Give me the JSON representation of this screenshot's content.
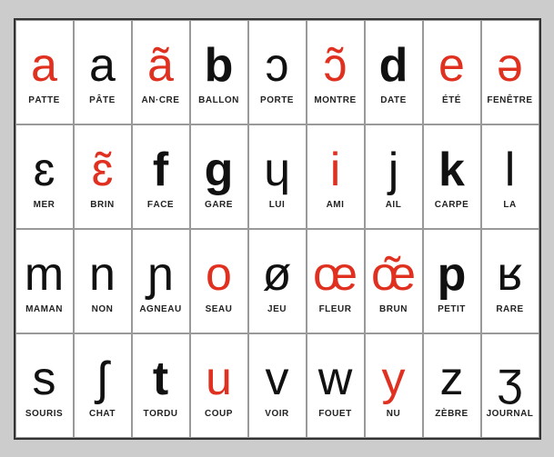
{
  "cells": [
    {
      "symbol": "a",
      "color": "red",
      "bold": false,
      "label": "PATTE",
      "labelBold": ""
    },
    {
      "symbol": "a",
      "color": "black",
      "bold": false,
      "label": "PÂTE",
      "labelBold": ""
    },
    {
      "symbol": "ã",
      "color": "red",
      "bold": false,
      "label": "AN·CRE",
      "labelBold": "AN",
      "labelRed": "AN"
    },
    {
      "symbol": "b",
      "color": "black",
      "bold": true,
      "label": "BALLON",
      "labelBold": "B"
    },
    {
      "symbol": "ɔ",
      "color": "black",
      "bold": false,
      "label": "PORTE",
      "labelBold": ""
    },
    {
      "symbol": "ɔ̃",
      "color": "red",
      "bold": false,
      "label": "MONTRE",
      "labelBold": "MON",
      "labelRed": "MON"
    },
    {
      "symbol": "d",
      "color": "black",
      "bold": true,
      "label": "DATE",
      "labelBold": "D"
    },
    {
      "symbol": "e",
      "color": "red",
      "bold": false,
      "label": "ÉTÉ",
      "labelBold": ""
    },
    {
      "symbol": "ə",
      "color": "red",
      "bold": false,
      "label": "FENÊTRE",
      "labelBold": ""
    },
    {
      "symbol": "ɛ",
      "color": "black",
      "bold": false,
      "label": "MER",
      "labelBold": ""
    },
    {
      "symbol": "ɛ̃",
      "color": "red",
      "bold": false,
      "label": "BRIN",
      "labelBold": ""
    },
    {
      "symbol": "f",
      "color": "black",
      "bold": true,
      "label": "FACE",
      "labelBold": "F"
    },
    {
      "symbol": "g",
      "color": "black",
      "bold": true,
      "label": "GARE",
      "labelBold": "G"
    },
    {
      "symbol": "ɥ",
      "color": "black",
      "bold": false,
      "label": "LUI",
      "labelBold": ""
    },
    {
      "symbol": "i",
      "color": "red",
      "bold": false,
      "label": "AMI",
      "labelBold": ""
    },
    {
      "symbol": "j",
      "color": "black",
      "bold": false,
      "label": "AIL",
      "labelBold": ""
    },
    {
      "symbol": "k",
      "color": "black",
      "bold": true,
      "label": "CARPE",
      "labelBold": "C"
    },
    {
      "symbol": "l",
      "color": "black",
      "bold": false,
      "label": "LA",
      "labelBold": ""
    },
    {
      "symbol": "m",
      "color": "black",
      "bold": false,
      "label": "MAMAN",
      "labelBold": ""
    },
    {
      "symbol": "n",
      "color": "black",
      "bold": false,
      "label": "NON",
      "labelBold": "N"
    },
    {
      "symbol": "ɲ",
      "color": "black",
      "bold": false,
      "label": "AGNEAU",
      "labelBold": "GN"
    },
    {
      "symbol": "o",
      "color": "red",
      "bold": false,
      "label": "SEAU",
      "labelBold": ""
    },
    {
      "symbol": "ø",
      "color": "black",
      "bold": false,
      "label": "JEU",
      "labelBold": ""
    },
    {
      "symbol": "œ",
      "color": "red",
      "bold": false,
      "label": "FLEUR",
      "labelBold": ""
    },
    {
      "symbol": "œ̃",
      "color": "red",
      "bold": false,
      "label": "BRUN",
      "labelBold": ""
    },
    {
      "symbol": "p",
      "color": "black",
      "bold": true,
      "label": "PETIT",
      "labelBold": "P"
    },
    {
      "symbol": "ʁ",
      "color": "black",
      "bold": false,
      "label": "RARE",
      "labelBold": ""
    },
    {
      "symbol": "s",
      "color": "black",
      "bold": false,
      "label": "SOURIS",
      "labelBold": ""
    },
    {
      "symbol": "ʃ",
      "color": "black",
      "bold": false,
      "label": "CHAT",
      "labelBold": "CH"
    },
    {
      "symbol": "t",
      "color": "black",
      "bold": true,
      "label": "TORDU",
      "labelBold": "T"
    },
    {
      "symbol": "u",
      "color": "red",
      "bold": false,
      "label": "COUP",
      "labelBold": ""
    },
    {
      "symbol": "v",
      "color": "black",
      "bold": false,
      "label": "VOIR",
      "labelBold": "V"
    },
    {
      "symbol": "w",
      "color": "black",
      "bold": false,
      "label": "FOUET",
      "labelBold": ""
    },
    {
      "symbol": "y",
      "color": "red",
      "bold": false,
      "label": "NU",
      "labelBold": ""
    },
    {
      "symbol": "z",
      "color": "black",
      "bold": false,
      "label": "ZÈBRE",
      "labelBold": "Z"
    },
    {
      "symbol": "ʒ",
      "color": "black",
      "bold": false,
      "label": "JOURNAL",
      "labelBold": "J"
    }
  ],
  "labelParts": [
    [
      "P",
      "ATTE"
    ],
    [
      "P",
      "ÂTE"
    ],
    [
      "",
      "ANCRE"
    ],
    [
      "",
      "BALLON"
    ],
    [
      "P",
      "ORTE"
    ],
    [
      "",
      "MONTRE"
    ],
    [
      "",
      "DATE"
    ],
    [
      "",
      "ÉTÉ"
    ],
    [
      "F",
      "ENÊTRE"
    ],
    [
      "M",
      "ER"
    ],
    [
      "BR",
      "IN"
    ],
    [
      "",
      "FACE"
    ],
    [
      "",
      "GARE"
    ],
    [
      "L",
      "UI"
    ],
    [
      "AM",
      "I"
    ],
    [
      "A",
      "IL"
    ],
    [
      "",
      "CARPE"
    ],
    [
      "L",
      "A"
    ],
    [
      "M",
      "AMAN"
    ],
    [
      "N",
      "ON"
    ],
    [
      "",
      "AGNEAU"
    ],
    [
      "S",
      "EAU"
    ],
    [
      "J",
      "EU"
    ],
    [
      "FL",
      "EUR"
    ],
    [
      "BR",
      "UN"
    ],
    [
      "P",
      "ETIT"
    ],
    [
      "R",
      "ARE"
    ],
    [
      "S",
      "OURIS"
    ],
    [
      "",
      "CHAT"
    ],
    [
      "T",
      "ORDU"
    ],
    [
      "C",
      "OUP"
    ],
    [
      "V",
      "OIR"
    ],
    [
      "F",
      "OUET"
    ],
    [
      "N",
      "U"
    ],
    [
      "Z",
      "ÈBRE"
    ],
    [
      "J",
      "OURNAL"
    ]
  ],
  "labelBolds": [
    "P",
    "P",
    "AN",
    "B",
    "P",
    "MON",
    "D",
    "",
    "F",
    "",
    "BR",
    "F",
    "G",
    "L",
    "AM",
    "A",
    "C",
    "L",
    "M",
    "N",
    "GN",
    "S",
    "J",
    "FL",
    "BR",
    "P",
    "R",
    "S",
    "CH",
    "T",
    "C",
    "V",
    "F",
    "N",
    "Z",
    "J"
  ]
}
